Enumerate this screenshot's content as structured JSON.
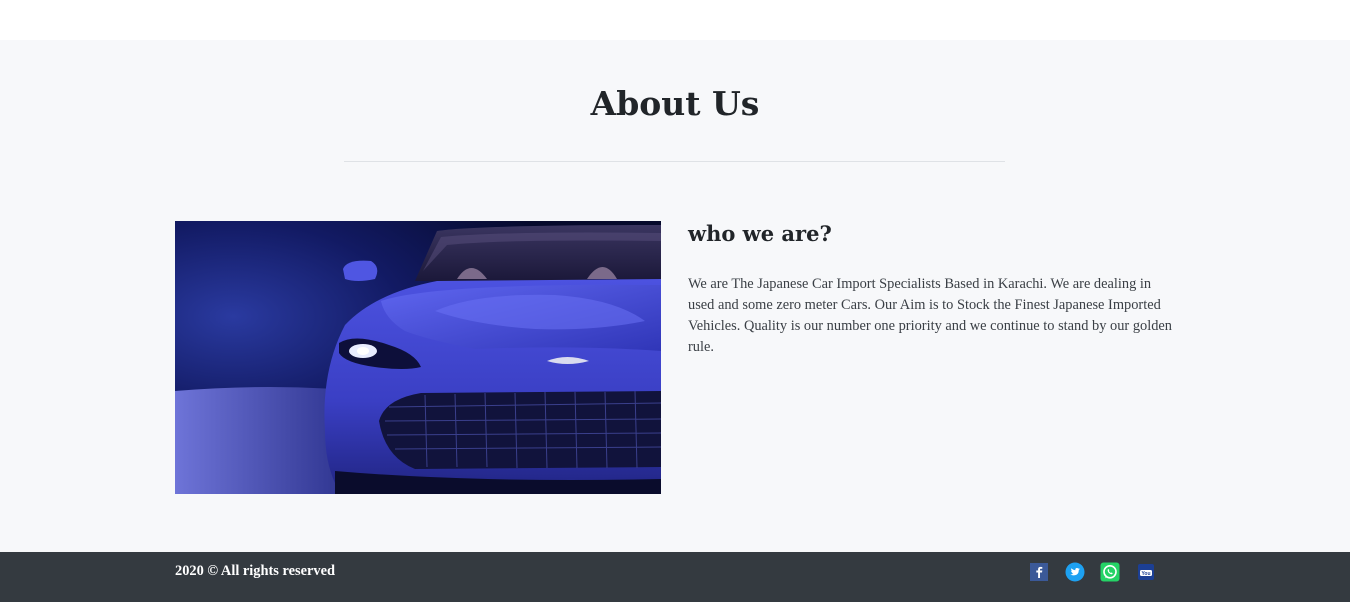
{
  "about": {
    "title": "About Us",
    "subheading": "who we are?",
    "text": "We are The Japanese Car Import Specialists Based in Karachi. We are dealing in used and some zero meter Cars. Our Aim is to Stock the Finest Japanese Imported Vehicles. Quality is our number one priority and we continue to stand by our golden rule."
  },
  "footer": {
    "copyright": "2020 © All rights reserved",
    "social": [
      {
        "icon": "facebook-icon",
        "color": "#3b5998"
      },
      {
        "icon": "twitter-icon",
        "color": "#1da1f2"
      },
      {
        "icon": "whatsapp-icon",
        "color": "#25d366"
      },
      {
        "icon": "youtube-icon",
        "color": "#1c3f94"
      }
    ]
  },
  "colors": {
    "section_bg": "#f7f8fa",
    "footer_bg": "#343a40",
    "car_body": "#3b40c4"
  }
}
